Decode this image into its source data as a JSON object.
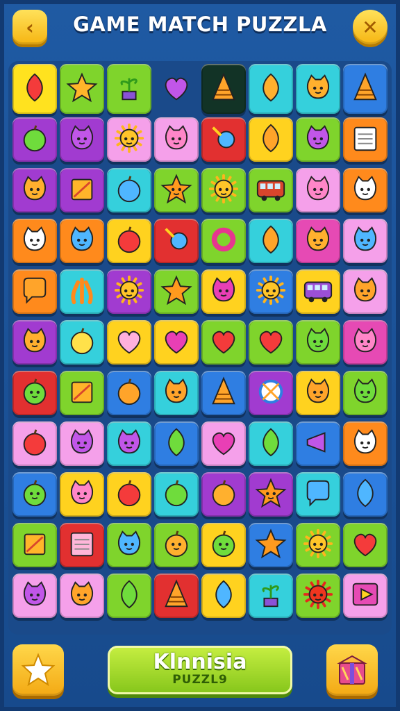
{
  "header": {
    "title": "GAME MATCH PUZZLA",
    "back_icon": "chevron-left-icon",
    "close_icon": "close-icon",
    "accent": "#f9c524"
  },
  "board": {
    "rows": [
      [
        {
          "bg": "#ffe21f",
          "icon": "leaf"
        },
        {
          "bg": "#7fd42c",
          "icon": "star-cone"
        },
        {
          "bg": "#7fd42c",
          "icon": "plant"
        },
        {
          "bg": "none",
          "icon": "heart-purple"
        },
        {
          "bg": "#123326",
          "icon": "stack-cone"
        },
        {
          "bg": "#35d0dc",
          "icon": "pear"
        },
        {
          "bg": "#35d0dc",
          "icon": "ghost"
        },
        {
          "bg": "#2f7ee2",
          "icon": "icecream"
        }
      ],
      [
        {
          "bg": "#a13bd0",
          "icon": "apple-green"
        },
        {
          "bg": "#a13bd0",
          "icon": "monster-purple"
        },
        {
          "bg": "#f5a0ea",
          "icon": "sun"
        },
        {
          "bg": "#f5a0ea",
          "icon": "blob-pink"
        },
        {
          "bg": "#e23030",
          "icon": "bird-blue"
        },
        {
          "bg": "#ffd21f",
          "icon": "drop-orange"
        },
        {
          "bg": "#7fd42c",
          "icon": "crab-purple"
        },
        {
          "bg": "#ff8a1c",
          "icon": "notepad"
        }
      ],
      [
        {
          "bg": "#a13bd0",
          "icon": "frog"
        },
        {
          "bg": "#a13bd0",
          "icon": "box"
        },
        {
          "bg": "#35d0dc",
          "icon": "apple-blue"
        },
        {
          "bg": "#7fd42c",
          "icon": "star-face"
        },
        {
          "bg": "#7fd42c",
          "icon": "sun-orange"
        },
        {
          "bg": "#7fd42c",
          "icon": "bus-red"
        },
        {
          "bg": "#f5a0ea",
          "icon": "monster-pink"
        },
        {
          "bg": "#ff8a1c",
          "icon": "fish-white"
        }
      ],
      [
        {
          "bg": "#ff8a1c",
          "icon": "bear-white"
        },
        {
          "bg": "#ff8a1c",
          "icon": "cat-blue"
        },
        {
          "bg": "#ffd21f",
          "icon": "apple-red"
        },
        {
          "bg": "#e23030",
          "icon": "rattle"
        },
        {
          "bg": "#7fd42c",
          "icon": "ring"
        },
        {
          "bg": "#35d0dc",
          "icon": "leaf-orange"
        },
        {
          "bg": "#e64ab4",
          "icon": "dog"
        },
        {
          "bg": "#f5a0ea",
          "icon": "bear-blue"
        }
      ],
      [
        {
          "bg": "#ff8a1c",
          "icon": "speech-orange"
        },
        {
          "bg": "#35d0dc",
          "icon": "coral"
        },
        {
          "bg": "#a13bd0",
          "icon": "sun"
        },
        {
          "bg": "#7fd42c",
          "icon": "star-orange"
        },
        {
          "bg": "#ffd21f",
          "icon": "blob-magenta"
        },
        {
          "bg": "#2f7ee2",
          "icon": "sun-orange"
        },
        {
          "bg": "#ffd21f",
          "icon": "bus-purple"
        },
        {
          "bg": "#f5a0ea",
          "icon": "bear-orange"
        }
      ],
      [
        {
          "bg": "#a13bd0",
          "icon": "frog-face"
        },
        {
          "bg": "#35d0dc",
          "icon": "apple-yellow"
        },
        {
          "bg": "#ffd21f",
          "icon": "heart-pink"
        },
        {
          "bg": "#ffd21f",
          "icon": "heart-magenta"
        },
        {
          "bg": "#7fd42c",
          "icon": "heart-red"
        },
        {
          "bg": "#7fd42c",
          "icon": "heart-red"
        },
        {
          "bg": "#7fd42c",
          "icon": "blob-green"
        },
        {
          "bg": "#e64ab4",
          "icon": "cat-pink"
        }
      ],
      [
        {
          "bg": "#e23030",
          "icon": "ball-green"
        },
        {
          "bg": "#7fd42c",
          "icon": "mat"
        },
        {
          "bg": "#2f7ee2",
          "icon": "apple-orange"
        },
        {
          "bg": "#35d0dc",
          "icon": "cat-orange"
        },
        {
          "bg": "#2f7ee2",
          "icon": "cone-orange"
        },
        {
          "bg": "#a13bd0",
          "icon": "wheel"
        },
        {
          "bg": "#ffd21f",
          "icon": "blob-orange"
        },
        {
          "bg": "#7fd42c",
          "icon": "cat-green"
        }
      ],
      [
        {
          "bg": "#f5a0ea",
          "icon": "apple-red2"
        },
        {
          "bg": "#f5a0ea",
          "icon": "blob-purple"
        },
        {
          "bg": "#35d0dc",
          "icon": "monster-purple"
        },
        {
          "bg": "#2f7ee2",
          "icon": "leaf-green"
        },
        {
          "bg": "#f5a0ea",
          "icon": "heart-magenta"
        },
        {
          "bg": "#35d0dc",
          "icon": "leaf-green"
        },
        {
          "bg": "#2f7ee2",
          "icon": "horn"
        },
        {
          "bg": "#ff8a1c",
          "icon": "cat-white"
        }
      ],
      [
        {
          "bg": "#2f7ee2",
          "icon": "ball-green"
        },
        {
          "bg": "#ffd21f",
          "icon": "blob-pink2"
        },
        {
          "bg": "#ffd21f",
          "icon": "apple-red"
        },
        {
          "bg": "#35d0dc",
          "icon": "apple-green"
        },
        {
          "bg": "#a13bd0",
          "icon": "lime"
        },
        {
          "bg": "#a13bd0",
          "icon": "star-face-orange"
        },
        {
          "bg": "#35d0dc",
          "icon": "speech-blue"
        },
        {
          "bg": "#2f7ee2",
          "icon": "drop-blue"
        }
      ],
      [
        {
          "bg": "#7fd42c",
          "icon": "sign"
        },
        {
          "bg": "#e23030",
          "icon": "notepad-pink"
        },
        {
          "bg": "#7fd42c",
          "icon": "monster-blue"
        },
        {
          "bg": "#7fd42c",
          "icon": "balloon"
        },
        {
          "bg": "#ffd21f",
          "icon": "ball-green"
        },
        {
          "bg": "#2f7ee2",
          "icon": "star-orange"
        },
        {
          "bg": "#7fd42c",
          "icon": "sun-orange"
        },
        {
          "bg": "#7fd42c",
          "icon": "heart-red"
        }
      ],
      [
        {
          "bg": "#f5a0ea",
          "icon": "cat-purple"
        },
        {
          "bg": "#f5a0ea",
          "icon": "bear-orange"
        },
        {
          "bg": "#7fd42c",
          "icon": "leaf-green"
        },
        {
          "bg": "#e23030",
          "icon": "cone-orange"
        },
        {
          "bg": "#ffd21f",
          "icon": "leaf-blue"
        },
        {
          "bg": "#35d0dc",
          "icon": "plant-green"
        },
        {
          "bg": "#7fd42c",
          "icon": "sun-red"
        },
        {
          "bg": "#f5a0ea",
          "icon": "play"
        }
      ]
    ]
  },
  "footer": {
    "star_icon": "star-icon",
    "center_line1": "Klnnisia",
    "center_line2": "PUZZL9",
    "box_icon": "gift-box-icon",
    "button_color": "#a6dc2a"
  }
}
